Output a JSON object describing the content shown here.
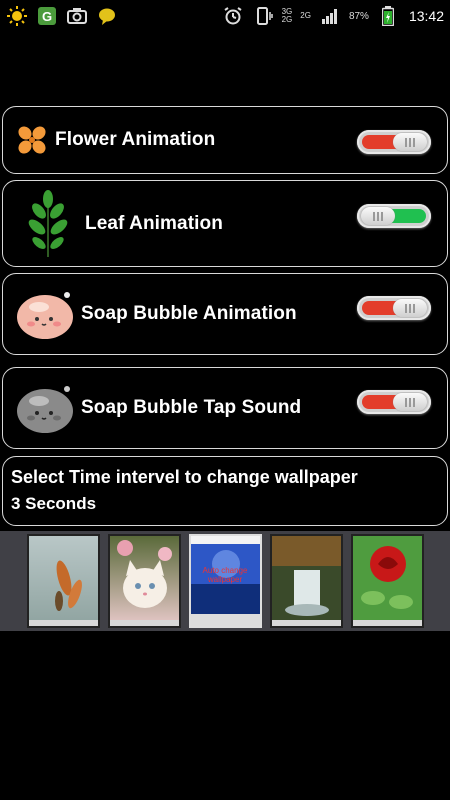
{
  "status_bar": {
    "time": "13:42",
    "battery_percent": "87%",
    "network_3g": "3G",
    "network_2g": "2G",
    "network_2g_small": "2G",
    "icons": [
      "sun-icon",
      "app-g-icon",
      "camera-icon",
      "chat-bubble-icon",
      "alarm-icon",
      "vibrate-icon",
      "signal-icon",
      "battery-icon"
    ]
  },
  "settings": {
    "flower": {
      "label": "Flower Animation",
      "enabled": false
    },
    "leaf": {
      "label": "Leaf Animation",
      "enabled": true
    },
    "soap_bubble": {
      "label": "Soap Bubble Animation",
      "enabled": false
    },
    "tap_sound": {
      "label": "Soap Bubble Tap Sound",
      "enabled": false
    }
  },
  "interval": {
    "title": "Select Time intervel to change wallpaper",
    "value": "3 Seconds"
  },
  "gallery": {
    "items": [
      "koi-fish-wallpaper",
      "kitten-wallpaper",
      "blue-scenery-wallpaper",
      "waterfall-wallpaper",
      "red-rose-wallpaper"
    ],
    "screenshot_caption": "Auto change wallpaper"
  },
  "colors": {
    "background": "#000000",
    "toggle_off": "#e33d2b",
    "toggle_on": "#20c050",
    "border": "#d9d9d9",
    "gallery_bg": "#404046"
  }
}
